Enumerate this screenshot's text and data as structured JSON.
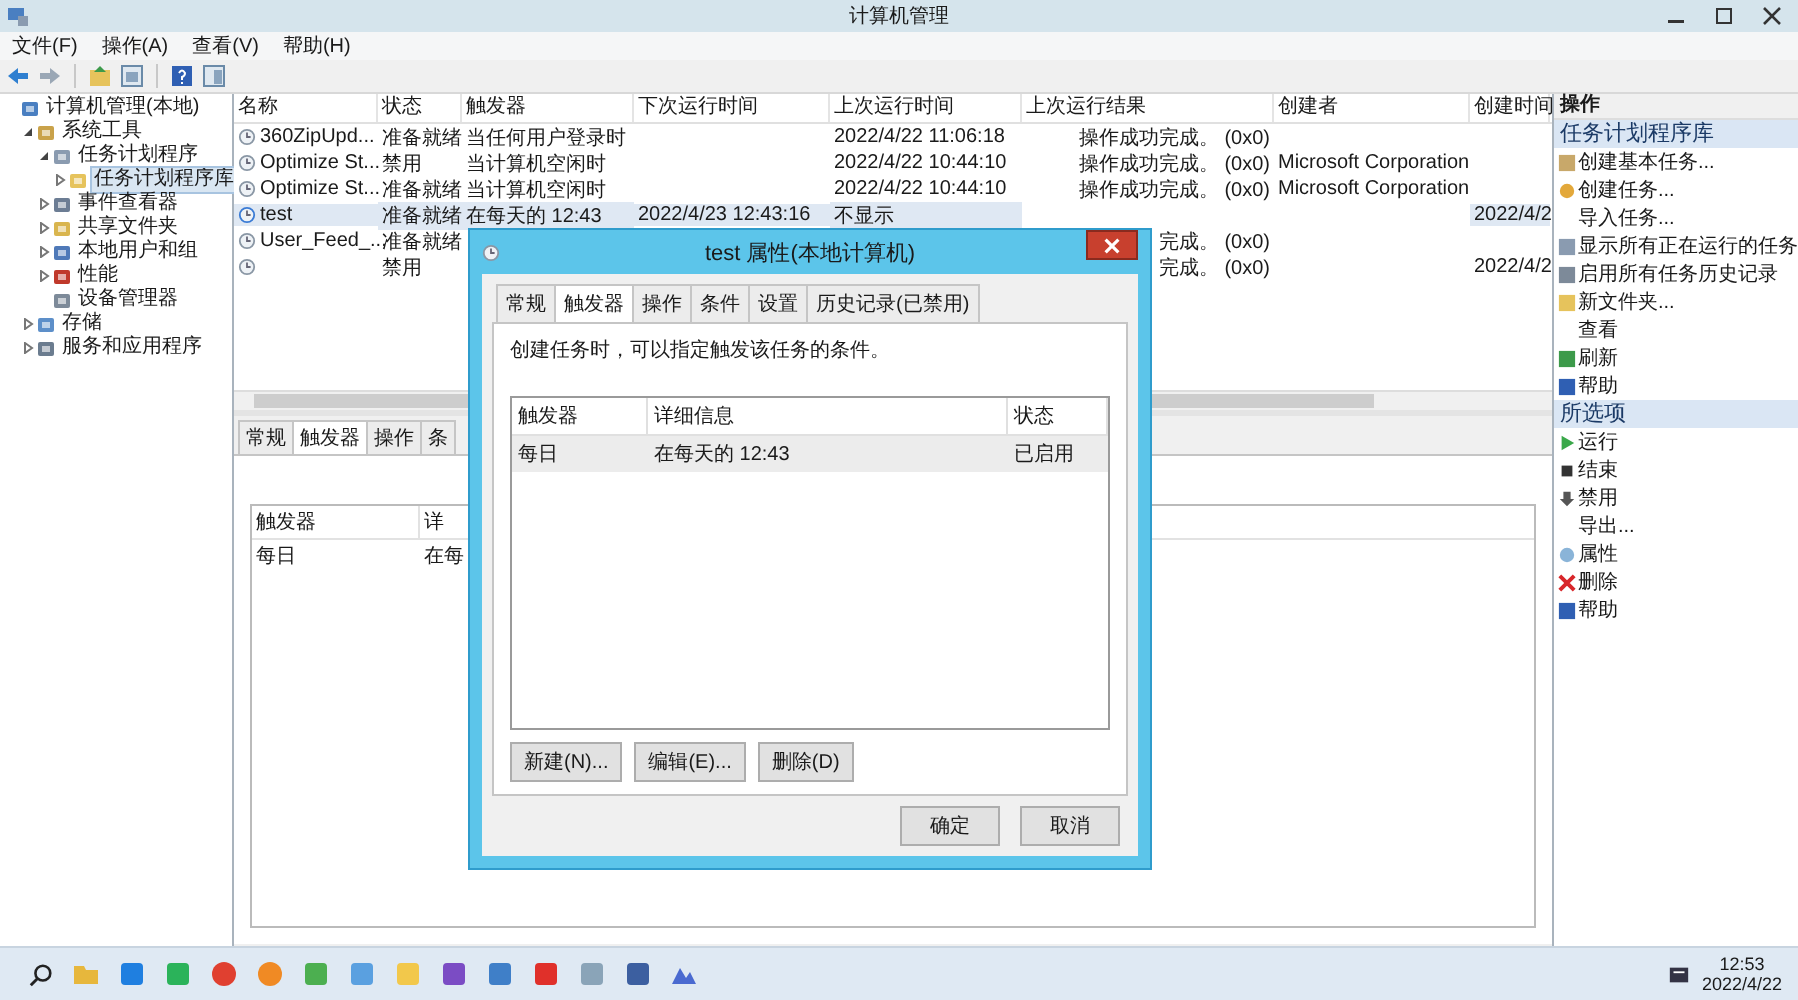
{
  "window": {
    "title": "计算机管理"
  },
  "menu": [
    "文件(F)",
    "操作(A)",
    "查看(V)",
    "帮助(H)"
  ],
  "tree": [
    {
      "label": "计算机管理(本地)",
      "selected": false,
      "children": [
        {
          "label": "系统工具",
          "expanded": true,
          "selected": false,
          "children": [
            {
              "label": "任务计划程序",
              "expanded": true,
              "selected": false,
              "children": [
                {
                  "label": "任务计划程序库",
                  "expanded": false,
                  "selected": true
                }
              ]
            },
            {
              "label": "事件查看器",
              "expanded": false,
              "selected": false
            },
            {
              "label": "共享文件夹",
              "expanded": false,
              "selected": false
            },
            {
              "label": "本地用户和组",
              "expanded": false,
              "selected": false
            },
            {
              "label": "性能",
              "expanded": false,
              "selected": false
            },
            {
              "label": "设备管理器",
              "selected": false
            }
          ]
        },
        {
          "label": "存储",
          "expanded": false,
          "selected": false
        },
        {
          "label": "服务和应用程序",
          "expanded": false,
          "selected": false
        }
      ]
    }
  ],
  "task_table": {
    "columns": [
      "名称",
      "状态",
      "触发器",
      "下次运行时间",
      "上次运行时间",
      "上次运行结果",
      "创建者",
      "创建时间"
    ],
    "rows": [
      {
        "name": "360ZipUpd...",
        "status": "准备就绪",
        "trigger": "当任何用户登录时",
        "last_run": "2022/4/22 11:06:18",
        "last_result": "操作成功完成。 (0x0)",
        "selected": false
      },
      {
        "name": "Optimize St...",
        "status": "禁用",
        "trigger": "当计算机空闲时",
        "last_run": "2022/4/22 10:44:10",
        "last_result": "操作成功完成。 (0x0)",
        "creator": "Microsoft Corporation",
        "selected": false
      },
      {
        "name": "Optimize St...",
        "status": "准备就绪",
        "trigger": "当计算机空闲时",
        "last_run": "2022/4/22 10:44:10",
        "last_result": "操作成功完成。 (0x0)",
        "creator": "Microsoft Corporation",
        "selected": false
      },
      {
        "name": "test",
        "status": "准备就绪",
        "trigger": "在每天的 12:43",
        "next_run": "2022/4/23 12:43:16",
        "last_run": "不显示",
        "created": "2022/4/2",
        "selected": true
      },
      {
        "name": "User_Feed_...",
        "status": "准备就绪",
        "last_result": "完成。 (0x0)",
        "selected": false
      },
      {
        "status": "禁用",
        "last_result": "完成。 (0x0)",
        "created": "2022/4/2",
        "selected": false
      }
    ]
  },
  "detail_pane": {
    "tabs": [
      {
        "label": "常规",
        "selected": false
      },
      {
        "label": "触发器",
        "selected": true
      },
      {
        "label": "操作",
        "selected": false
      },
      {
        "label": "条",
        "selected": false
      }
    ],
    "columns": [
      "触发器",
      "详"
    ],
    "rows": [
      [
        "每日",
        "在每"
      ]
    ]
  },
  "dialog": {
    "title": "test 属性(本地计算机)",
    "tabs": [
      {
        "label": "常规",
        "selected": false
      },
      {
        "label": "触发器",
        "selected": true
      },
      {
        "label": "操作",
        "selected": false
      },
      {
        "label": "条件",
        "selected": false
      },
      {
        "label": "设置",
        "selected": false
      },
      {
        "label": "历史记录(已禁用)",
        "selected": false
      }
    ],
    "description": "创建任务时，可以指定触发该任务的条件。",
    "columns": [
      "触发器",
      "详细信息",
      "状态"
    ],
    "rows": [
      {
        "cells": [
          "每日",
          "在每天的 12:43",
          "已启用"
        ],
        "selected": true
      }
    ],
    "buttons": [
      "新建(N)...",
      "编辑(E)...",
      "删除(D)"
    ],
    "footer_buttons": [
      "确定",
      "取消"
    ]
  },
  "actions_panel": {
    "title": "操作",
    "sections": [
      {
        "title": "任务计划程序库",
        "items": [
          "创建基本任务...",
          "创建任务...",
          "导入任务...",
          "显示所有正在运行的任务",
          "启用所有任务历史记录",
          "新文件夹...",
          "查看",
          "刷新",
          "帮助"
        ]
      },
      {
        "title": "所选项",
        "items": [
          "运行",
          "结束",
          "禁用",
          "导出...",
          "属性",
          "删除",
          "帮助"
        ]
      }
    ]
  },
  "taskbar": {
    "clock_time": "12:53",
    "clock_date": "2022/4/22"
  }
}
